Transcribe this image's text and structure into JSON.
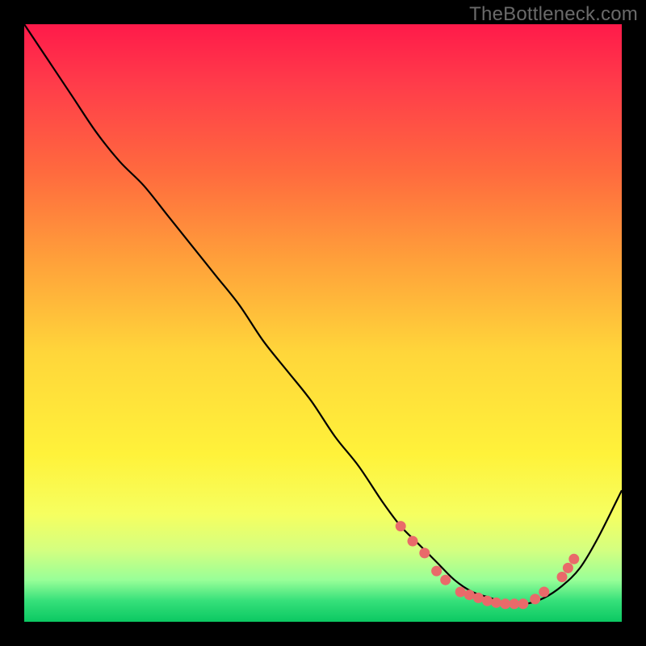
{
  "watermark": "TheBottleneck.com",
  "colors": {
    "line": "#000000",
    "dots": "#e96a6a",
    "frame_bg": "#000000"
  },
  "gradient_stops": [
    {
      "offset": 0.0,
      "color": "#ff1a4a"
    },
    {
      "offset": 0.1,
      "color": "#ff3c4a"
    },
    {
      "offset": 0.25,
      "color": "#ff6b3e"
    },
    {
      "offset": 0.4,
      "color": "#ffa23a"
    },
    {
      "offset": 0.55,
      "color": "#ffd63a"
    },
    {
      "offset": 0.72,
      "color": "#fff23a"
    },
    {
      "offset": 0.82,
      "color": "#f6ff60"
    },
    {
      "offset": 0.88,
      "color": "#d4ff80"
    },
    {
      "offset": 0.93,
      "color": "#98ff98"
    },
    {
      "offset": 0.965,
      "color": "#36e07a"
    },
    {
      "offset": 1.0,
      "color": "#0bc862"
    }
  ],
  "chart_data": {
    "type": "line",
    "title": "",
    "xlabel": "",
    "ylabel": "",
    "xlim": [
      0,
      100
    ],
    "ylim": [
      0,
      100
    ],
    "series": [
      {
        "name": "curve",
        "x": [
          0,
          4,
          8,
          12,
          16,
          20,
          24,
          28,
          32,
          36,
          40,
          44,
          48,
          52,
          56,
          60,
          63,
          66,
          69,
          72,
          75,
          78,
          81,
          84,
          87,
          90,
          93,
          96,
          100
        ],
        "y": [
          100,
          94,
          88,
          82,
          77,
          73,
          68,
          63,
          58,
          53,
          47,
          42,
          37,
          31,
          26,
          20,
          16,
          13,
          10,
          7,
          5,
          4,
          3,
          3,
          4,
          6,
          9,
          14,
          22
        ]
      }
    ],
    "dots": [
      {
        "x": 63,
        "y": 16
      },
      {
        "x": 65,
        "y": 13.5
      },
      {
        "x": 67,
        "y": 11.5
      },
      {
        "x": 69,
        "y": 8.5
      },
      {
        "x": 70.5,
        "y": 7
      },
      {
        "x": 73,
        "y": 5
      },
      {
        "x": 74.5,
        "y": 4.5
      },
      {
        "x": 76,
        "y": 4
      },
      {
        "x": 77.5,
        "y": 3.5
      },
      {
        "x": 79,
        "y": 3.2
      },
      {
        "x": 80.5,
        "y": 3
      },
      {
        "x": 82,
        "y": 3
      },
      {
        "x": 83.5,
        "y": 3
      },
      {
        "x": 85.5,
        "y": 3.8
      },
      {
        "x": 87,
        "y": 5
      },
      {
        "x": 90,
        "y": 7.5
      },
      {
        "x": 91,
        "y": 9
      },
      {
        "x": 92,
        "y": 10.5
      }
    ]
  }
}
